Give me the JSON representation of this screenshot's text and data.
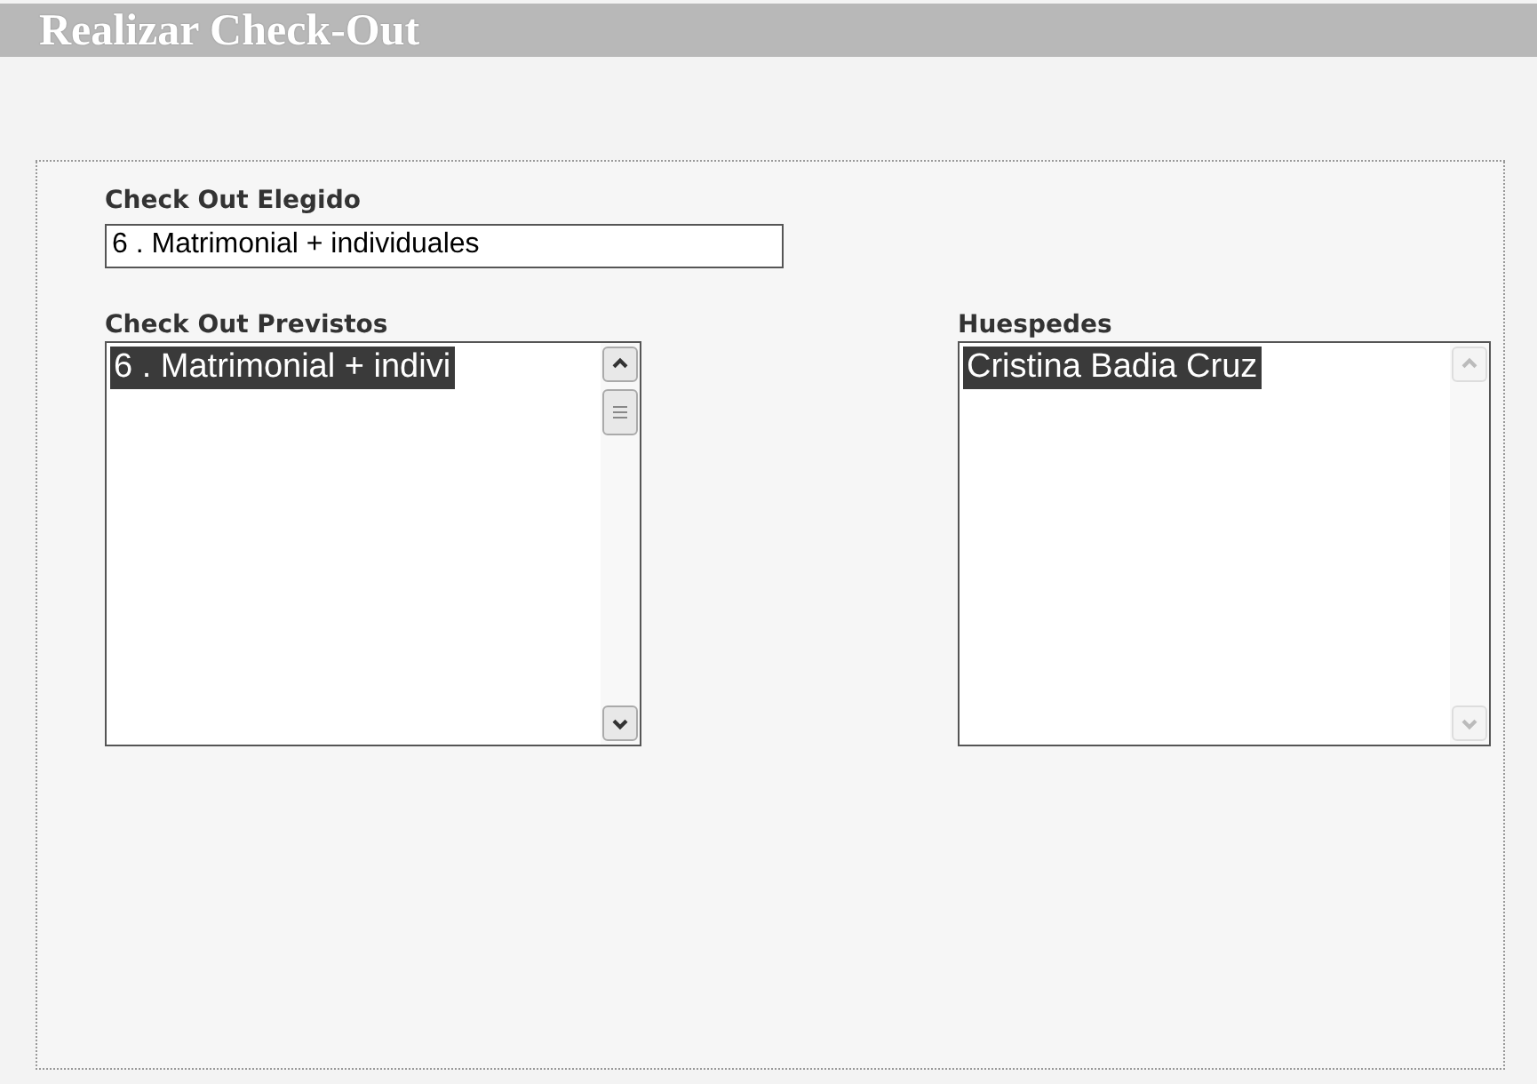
{
  "window": {
    "title": "Realizar Check-Out"
  },
  "chosen": {
    "label": "Check Out Elegido",
    "value": "6 . Matrimonial + individuales"
  },
  "lists": [
    {
      "label": "Check Out Previstos",
      "scrollbar_enabled": true,
      "items": [
        {
          "text": "6 . Matrimonial + indivi",
          "selected": true
        }
      ]
    },
    {
      "label": "Huespedes",
      "scrollbar_enabled": false,
      "items": [
        {
          "text": "Cristina Badia Cruz",
          "selected": true
        }
      ]
    }
  ]
}
